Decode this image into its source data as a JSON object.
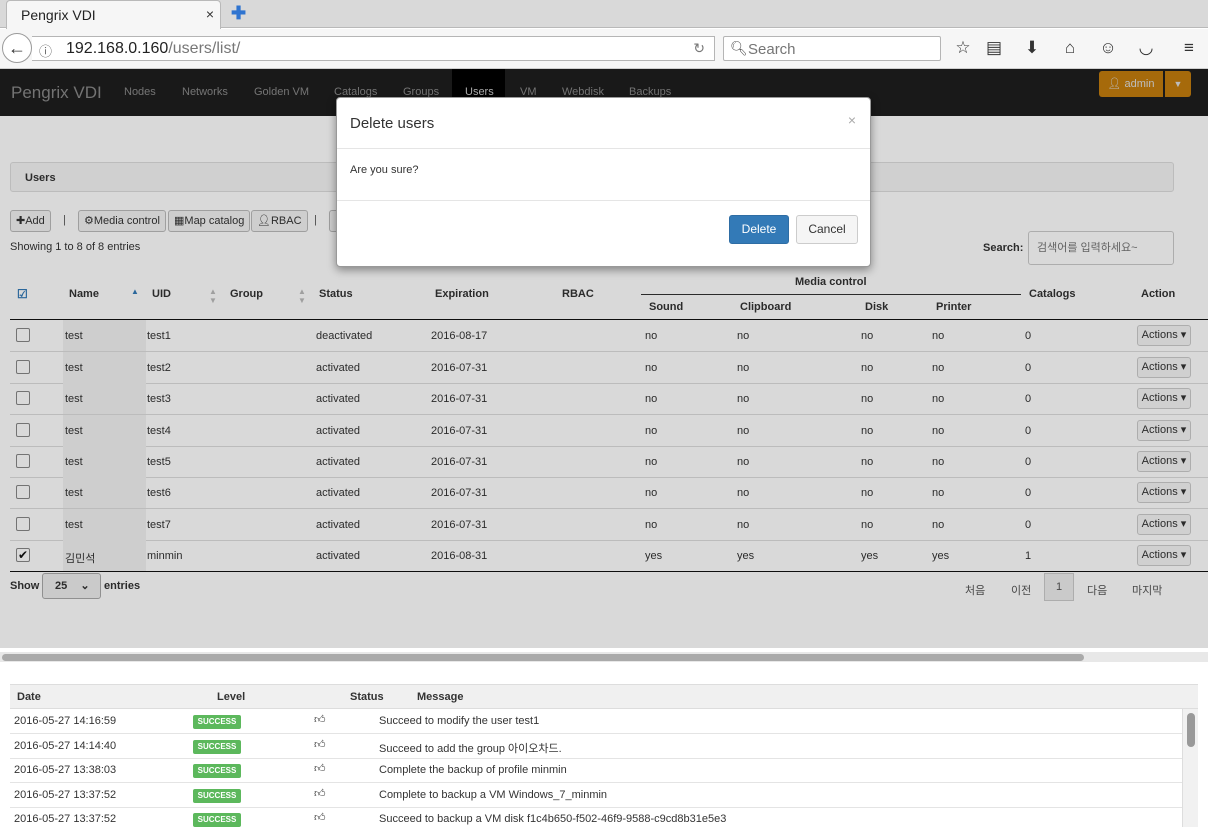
{
  "browser": {
    "tab_title": "Pengrix VDI",
    "tab_close": "×",
    "new_tab": "✚",
    "url_host": "192.168.0.160",
    "url_path": "/users/list/",
    "search_placeholder": "Search"
  },
  "app": {
    "brand": "Pengrix VDI",
    "nav": [
      "Nodes",
      "Networks",
      "Golden VM",
      "Catalogs",
      "Groups",
      "Users",
      "VM",
      "Webdisk",
      "Backups"
    ],
    "active_nav": "Users",
    "admin_label": "admin"
  },
  "users_panel": {
    "title": "Users",
    "toolbar": {
      "add": "Add",
      "media_control": "Media control",
      "map_catalog": "Map catalog",
      "rbac": "RBAC",
      "separator": "|"
    },
    "showing": "Showing 1 to 8 of 8 entries",
    "search_label": "Search:",
    "search_placeholder": "검색어를 입력하세요~",
    "columns": {
      "name": "Name",
      "uid": "UID",
      "group": "Group",
      "status": "Status",
      "expiration": "Expiration",
      "rbac": "RBAC",
      "media_control": "Media control",
      "sound": "Sound",
      "clipboard": "Clipboard",
      "disk": "Disk",
      "printer": "Printer",
      "catalogs": "Catalogs",
      "action": "Action"
    },
    "rows": [
      {
        "checked": false,
        "name": "test",
        "uid": "test1",
        "group": "",
        "status": "deactivated",
        "expiration": "2016-08-17",
        "rbac": "",
        "sound": "no",
        "clipboard": "no",
        "disk": "no",
        "printer": "no",
        "catalogs": "0",
        "action": "Actions"
      },
      {
        "checked": false,
        "name": "test",
        "uid": "test2",
        "group": "",
        "status": "activated",
        "expiration": "2016-07-31",
        "rbac": "",
        "sound": "no",
        "clipboard": "no",
        "disk": "no",
        "printer": "no",
        "catalogs": "0",
        "action": "Actions"
      },
      {
        "checked": false,
        "name": "test",
        "uid": "test3",
        "group": "",
        "status": "activated",
        "expiration": "2016-07-31",
        "rbac": "",
        "sound": "no",
        "clipboard": "no",
        "disk": "no",
        "printer": "no",
        "catalogs": "0",
        "action": "Actions"
      },
      {
        "checked": false,
        "name": "test",
        "uid": "test4",
        "group": "",
        "status": "activated",
        "expiration": "2016-07-31",
        "rbac": "",
        "sound": "no",
        "clipboard": "no",
        "disk": "no",
        "printer": "no",
        "catalogs": "0",
        "action": "Actions"
      },
      {
        "checked": false,
        "name": "test",
        "uid": "test5",
        "group": "",
        "status": "activated",
        "expiration": "2016-07-31",
        "rbac": "",
        "sound": "no",
        "clipboard": "no",
        "disk": "no",
        "printer": "no",
        "catalogs": "0",
        "action": "Actions"
      },
      {
        "checked": false,
        "name": "test",
        "uid": "test6",
        "group": "",
        "status": "activated",
        "expiration": "2016-07-31",
        "rbac": "",
        "sound": "no",
        "clipboard": "no",
        "disk": "no",
        "printer": "no",
        "catalogs": "0",
        "action": "Actions"
      },
      {
        "checked": false,
        "name": "test",
        "uid": "test7",
        "group": "",
        "status": "activated",
        "expiration": "2016-07-31",
        "rbac": "",
        "sound": "no",
        "clipboard": "no",
        "disk": "no",
        "printer": "no",
        "catalogs": "0",
        "action": "Actions"
      },
      {
        "checked": true,
        "name": "김민석",
        "uid": "minmin",
        "group": "",
        "status": "activated",
        "expiration": "2016-08-31",
        "rbac": "",
        "sound": "yes",
        "clipboard": "yes",
        "disk": "yes",
        "printer": "yes",
        "catalogs": "1",
        "action": "Actions"
      }
    ],
    "length": {
      "show": "Show",
      "value": "25",
      "entries": "entries"
    },
    "pagination": {
      "first": "처음",
      "prev": "이전",
      "current": "1",
      "next": "다음",
      "last": "마지막"
    }
  },
  "log": {
    "columns": {
      "date": "Date",
      "level": "Level",
      "status": "Status",
      "message": "Message"
    },
    "rows": [
      {
        "date": "2016-05-27 14:16:59",
        "level": "SUCCESS",
        "message": "Succeed to modify the user test1"
      },
      {
        "date": "2016-05-27 14:14:40",
        "level": "SUCCESS",
        "message": "Succeed to add the group 아이오차드."
      },
      {
        "date": "2016-05-27 13:38:03",
        "level": "SUCCESS",
        "message": "Complete the backup of profile minmin"
      },
      {
        "date": "2016-05-27 13:37:52",
        "level": "SUCCESS",
        "message": "Complete to backup a VM Windows_7_minmin"
      },
      {
        "date": "2016-05-27 13:37:52",
        "level": "SUCCESS",
        "message": "Succeed to backup a VM disk f1c4b650-f502-46f9-9588-c9cd8b31e5e3"
      }
    ]
  },
  "modal": {
    "title": "Delete users",
    "close": "×",
    "body": "Are you sure?",
    "delete": "Delete",
    "cancel": "Cancel"
  },
  "colors": {
    "primary": "#337ab7",
    "success": "#5cb85c",
    "admin": "#e08e0b",
    "header": "#1e1e1e"
  }
}
